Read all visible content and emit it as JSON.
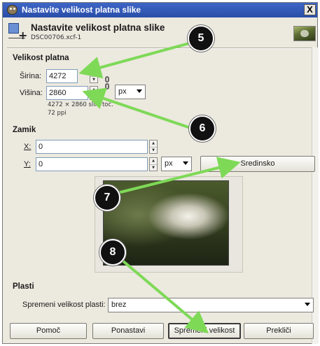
{
  "window": {
    "title": "Nastavite velikost platna slike",
    "close_label": "X"
  },
  "header": {
    "title": "Nastavite velikost platna slike",
    "subtitle": "DSC00706.xcf-1"
  },
  "canvas_size": {
    "section": "Velikost platna",
    "width_label": "Širina:",
    "width_value": "4272",
    "height_label": "Višina:",
    "height_value": "2860",
    "unit": "px",
    "info_pixels": "4272 × 2860 slik. toč.",
    "info_ppi": "72 ppi"
  },
  "offset": {
    "section": "Zamik",
    "x_label": "X:",
    "x_value": "0",
    "y_label": "Y:",
    "y_value": "0",
    "unit": "px",
    "center_button": "Sredinsko"
  },
  "layers": {
    "section": "Plasti",
    "resize_label": "Spremeni velikost plasti:",
    "resize_value": "brez"
  },
  "buttons": {
    "help": "Pomoč",
    "reset": "Ponastavi",
    "resize": "Spremeni velikost",
    "cancel": "Prekliči"
  },
  "callouts": [
    "5",
    "6",
    "7",
    "8"
  ],
  "colors": {
    "titlebar": "#2f56b5",
    "arrow": "#7ed957",
    "dialog_bg": "#ece9df"
  },
  "icons": [
    "gimp-wilber-icon",
    "canvas-size-icon",
    "chain-link-icon",
    "close-icon",
    "dropdown-arrow-icon"
  ]
}
